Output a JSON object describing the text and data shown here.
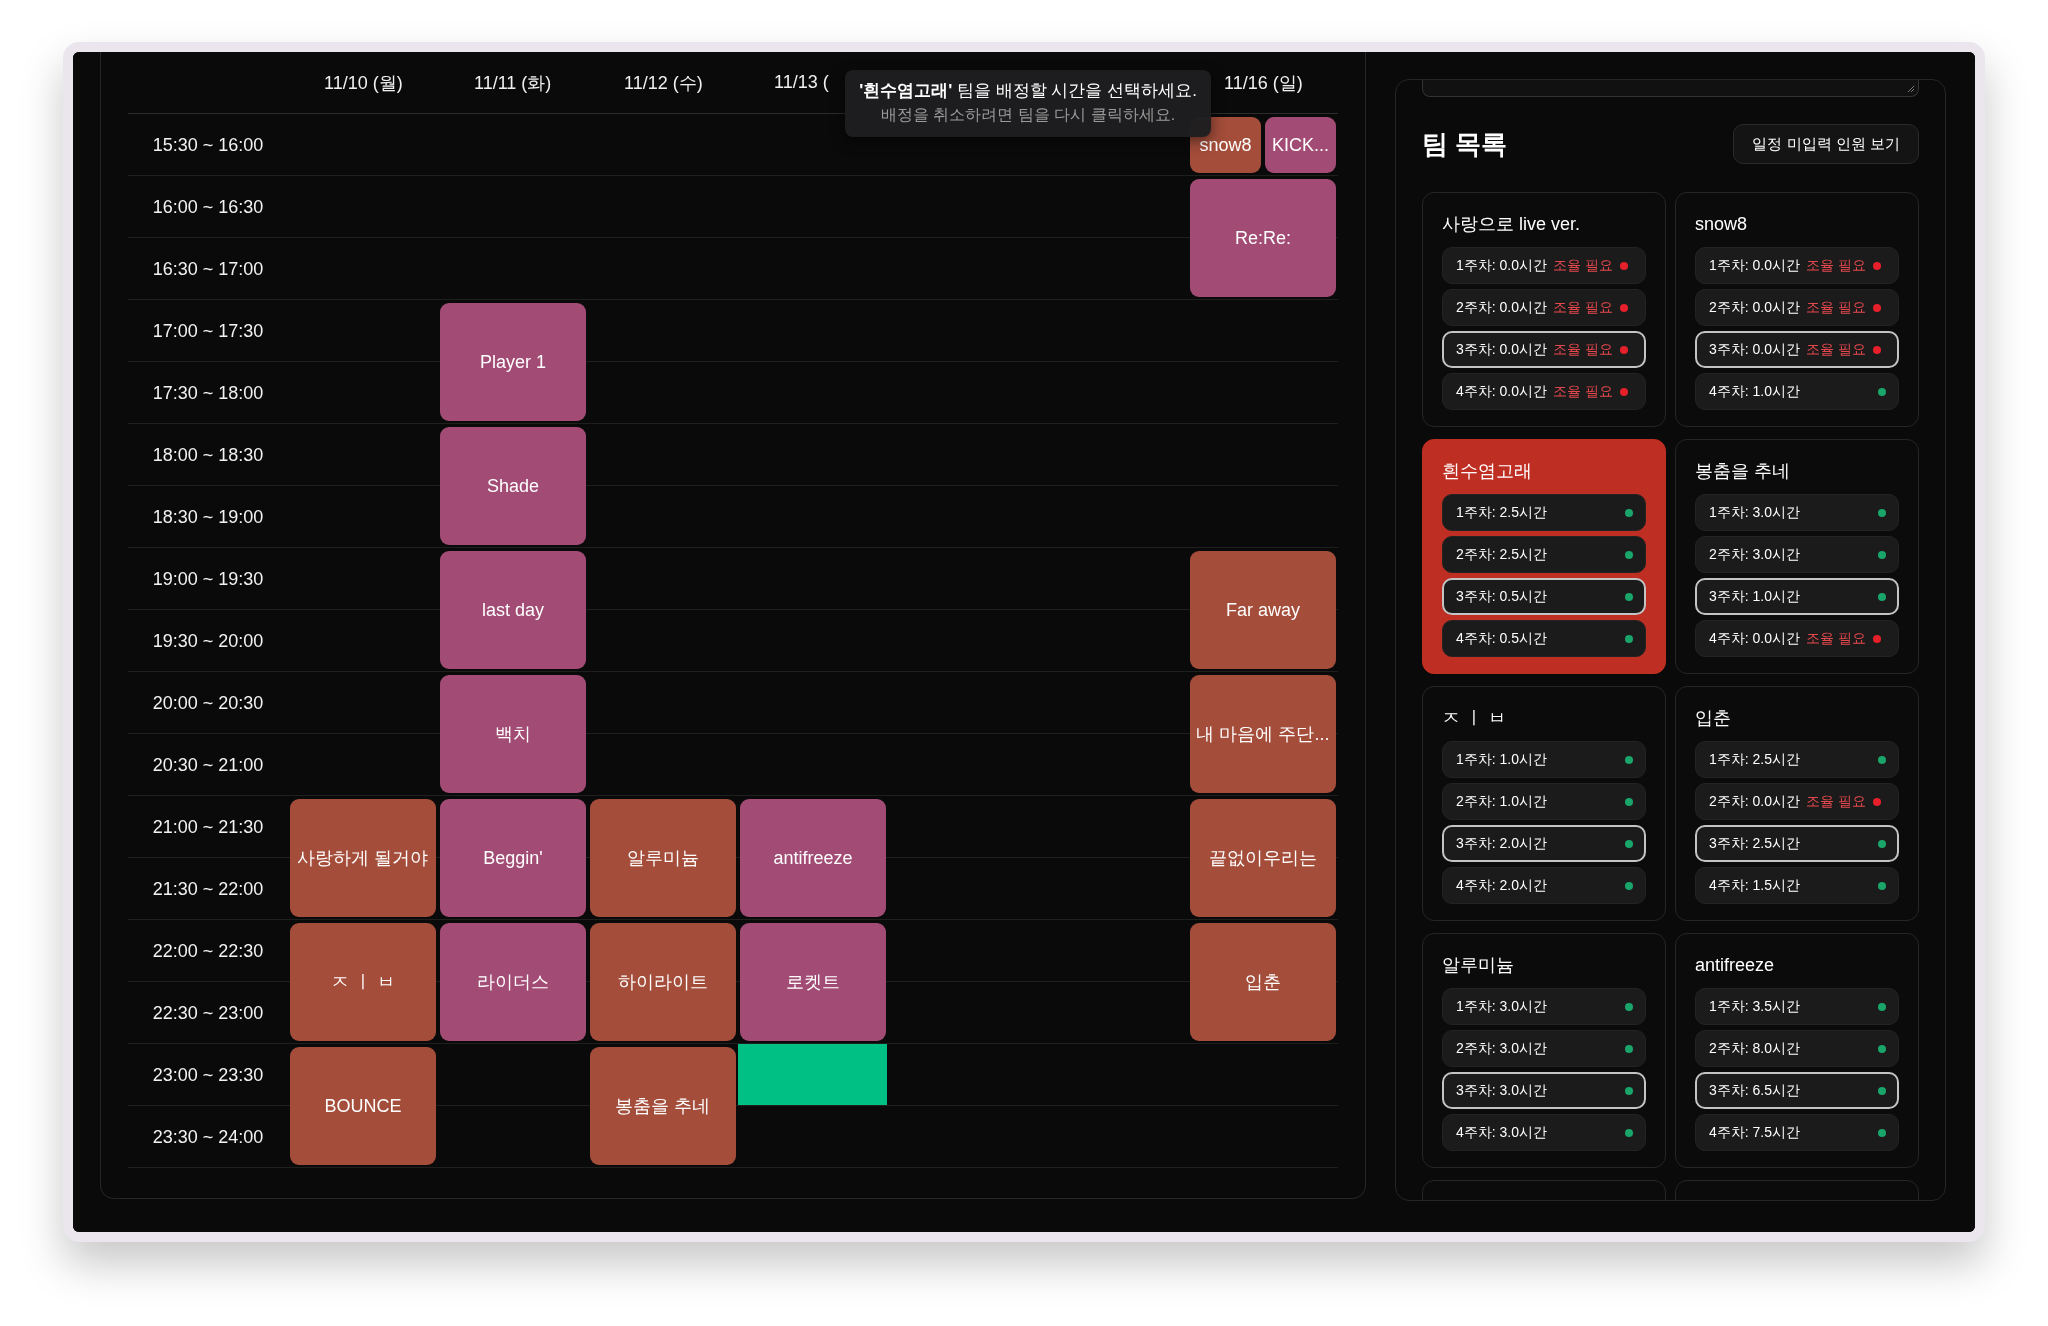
{
  "schedule": {
    "timeslots": [
      {
        "label": "15:30 ~ 16:00"
      },
      {
        "label": "16:00 ~ 16:30"
      },
      {
        "label": "16:30 ~ 17:00"
      },
      {
        "label": "17:00 ~ 17:30"
      },
      {
        "label": "17:30 ~ 18:00"
      },
      {
        "label": "18:00 ~ 18:30"
      },
      {
        "label": "18:30 ~ 19:00"
      },
      {
        "label": "19:00 ~ 19:30"
      },
      {
        "label": "19:30 ~ 20:00"
      },
      {
        "label": "20:00 ~ 20:30"
      },
      {
        "label": "20:30 ~ 21:00"
      },
      {
        "label": "21:00 ~ 21:30"
      },
      {
        "label": "21:30 ~ 22:00"
      },
      {
        "label": "22:00 ~ 22:30"
      },
      {
        "label": "22:30 ~ 23:00"
      },
      {
        "label": "23:00 ~ 23:30"
      },
      {
        "label": "23:30 ~ 24:00"
      }
    ],
    "days": [
      {
        "kind": "day",
        "label": "11/10 (월)",
        "events": [
          {
            "kind": "gap"
          },
          {
            "kind": "gap"
          },
          {
            "kind": "gap"
          },
          {
            "kind": "gap"
          },
          {
            "kind": "gap"
          },
          {
            "kind": "gap"
          },
          {
            "kind": "gap"
          },
          {
            "kind": "gap"
          },
          {
            "kind": "gap"
          },
          {
            "kind": "gap"
          },
          {
            "kind": "gap"
          },
          {
            "kind": "hour",
            "title": "사랑하게 될거야",
            "color": "#a34d3a"
          },
          {
            "kind": "hour",
            "title": "ㅈ ㅣ ㅂ",
            "color": "#a34d3a"
          },
          {
            "kind": "hour",
            "title": "BOUNCE",
            "color": "#a34d3a"
          }
        ]
      },
      {
        "kind": "day",
        "label": "11/11 (화)",
        "events": [
          {
            "kind": "gap"
          },
          {
            "kind": "gap"
          },
          {
            "kind": "gap"
          },
          {
            "kind": "hour",
            "title": "Player 1",
            "color": "#a24b74"
          },
          {
            "kind": "hour",
            "title": "Shade",
            "color": "#a24b74"
          },
          {
            "kind": "hour",
            "title": "last day",
            "color": "#a24b74"
          },
          {
            "kind": "hour",
            "title": "백치",
            "color": "#a24b74"
          },
          {
            "kind": "hour",
            "title": "Beggin'",
            "color": "#a24b74"
          },
          {
            "kind": "hour",
            "title": "라이더스",
            "color": "#a24b74"
          }
        ]
      },
      {
        "kind": "day",
        "label": "11/12 (수)",
        "events": [
          {
            "kind": "gap"
          },
          {
            "kind": "gap"
          },
          {
            "kind": "gap"
          },
          {
            "kind": "gap"
          },
          {
            "kind": "gap"
          },
          {
            "kind": "gap"
          },
          {
            "kind": "gap"
          },
          {
            "kind": "gap"
          },
          {
            "kind": "gap"
          },
          {
            "kind": "gap"
          },
          {
            "kind": "gap"
          },
          {
            "kind": "hour",
            "title": "알루미늄",
            "color": "#a34d3a"
          },
          {
            "kind": "hour",
            "title": "하이라이트",
            "color": "#a34d3a"
          },
          {
            "kind": "hour",
            "title": "봉춤을 추네",
            "color": "#a34d3a"
          }
        ]
      },
      {
        "kind": "day",
        "label": "11/13 (",
        "events": [
          {
            "kind": "gap"
          },
          {
            "kind": "gap"
          },
          {
            "kind": "gap"
          },
          {
            "kind": "gap"
          },
          {
            "kind": "gap"
          },
          {
            "kind": "gap"
          },
          {
            "kind": "gap"
          },
          {
            "kind": "gap"
          },
          {
            "kind": "gap"
          },
          {
            "kind": "gap"
          },
          {
            "kind": "gap"
          },
          {
            "kind": "hour",
            "title": "antifreeze",
            "color": "#a24b74"
          },
          {
            "kind": "hour",
            "title": "로켓트",
            "color": "#a24b74"
          },
          {
            "kind": "preview",
            "color": "#00c084"
          }
        ]
      },
      {
        "kind": "blank"
      },
      {
        "kind": "blank"
      },
      {
        "kind": "day",
        "label": "11/16 (일)",
        "events": [
          {
            "kind": "pair",
            "blocks": [
              {
                "title": "snow8",
                "color": "#a34d3a"
              },
              {
                "title": "KICK...",
                "color": "#a24b74"
              }
            ]
          },
          {
            "kind": "hour",
            "title": "Re:Re:",
            "color": "#a24b74"
          },
          {
            "kind": "gap"
          },
          {
            "kind": "gap"
          },
          {
            "kind": "gap"
          },
          {
            "kind": "gap"
          },
          {
            "kind": "hour",
            "title": "Far away",
            "color": "#a34d3a"
          },
          {
            "kind": "hour",
            "title": "내 마음에 주단...",
            "color": "#a34d3a"
          },
          {
            "kind": "hour",
            "title": "끝없이우리는",
            "color": "#a34d3a"
          },
          {
            "kind": "hour",
            "title": "입춘",
            "color": "#a34d3a"
          }
        ]
      }
    ]
  },
  "tooltip": {
    "title": "**'흰수염고래'** 팀을 배정할 시간을 선택하세요.",
    "hint": "배정을 취소하려면 팀을 다시 클릭하세요."
  },
  "team_panel": {
    "title": "팀 목록",
    "button": "일정 미입력 인원 보기"
  },
  "teams": [
    {
      "name": "사랑으로 live ver.",
      "selected": false,
      "weeks": [
        {
          "label": "1주차: 0.0시간",
          "warning": "조율 필요",
          "ok": false,
          "current": false
        },
        {
          "label": "2주차: 0.0시간",
          "warning": "조율 필요",
          "ok": false,
          "current": false
        },
        {
          "label": "3주차: 0.0시간",
          "warning": "조율 필요",
          "ok": false,
          "current": true
        },
        {
          "label": "4주차: 0.0시간",
          "warning": "조율 필요",
          "ok": false,
          "current": false
        }
      ]
    },
    {
      "name": "snow8",
      "selected": false,
      "weeks": [
        {
          "label": "1주차: 0.0시간",
          "warning": "조율 필요",
          "ok": false,
          "current": false
        },
        {
          "label": "2주차: 0.0시간",
          "warning": "조율 필요",
          "ok": false,
          "current": false
        },
        {
          "label": "3주차: 0.0시간",
          "warning": "조율 필요",
          "ok": false,
          "current": true
        },
        {
          "label": "4주차: 1.0시간",
          "ok": true,
          "current": false
        }
      ]
    },
    {
      "name": "흰수염고래",
      "selected": true,
      "weeks": [
        {
          "label": "1주차: 2.5시간",
          "ok": true,
          "current": false
        },
        {
          "label": "2주차: 2.5시간",
          "ok": true,
          "current": false
        },
        {
          "label": "3주차: 0.5시간",
          "ok": true,
          "current": true
        },
        {
          "label": "4주차: 0.5시간",
          "ok": true,
          "current": false
        }
      ]
    },
    {
      "name": "봉춤을 추네",
      "selected": false,
      "weeks": [
        {
          "label": "1주차: 3.0시간",
          "ok": true,
          "current": false
        },
        {
          "label": "2주차: 3.0시간",
          "ok": true,
          "current": false
        },
        {
          "label": "3주차: 1.0시간",
          "ok": true,
          "current": true
        },
        {
          "label": "4주차: 0.0시간",
          "warning": "조율 필요",
          "ok": false,
          "current": false
        }
      ]
    },
    {
      "name": "ㅈ ㅣ ㅂ",
      "selected": false,
      "weeks": [
        {
          "label": "1주차: 1.0시간",
          "ok": true,
          "current": false
        },
        {
          "label": "2주차: 1.0시간",
          "ok": true,
          "current": false
        },
        {
          "label": "3주차: 2.0시간",
          "ok": true,
          "current": true
        },
        {
          "label": "4주차: 2.0시간",
          "ok": true,
          "current": false
        }
      ]
    },
    {
      "name": "입춘",
      "selected": false,
      "weeks": [
        {
          "label": "1주차: 2.5시간",
          "ok": true,
          "current": false
        },
        {
          "label": "2주차: 0.0시간",
          "warning": "조율 필요",
          "ok": false,
          "current": false
        },
        {
          "label": "3주차: 2.5시간",
          "ok": true,
          "current": true
        },
        {
          "label": "4주차: 1.5시간",
          "ok": true,
          "current": false
        }
      ]
    },
    {
      "name": "알루미늄",
      "selected": false,
      "weeks": [
        {
          "label": "1주차: 3.0시간",
          "ok": true,
          "current": false
        },
        {
          "label": "2주차: 3.0시간",
          "ok": true,
          "current": false
        },
        {
          "label": "3주차: 3.0시간",
          "ok": true,
          "current": true
        },
        {
          "label": "4주차: 3.0시간",
          "ok": true,
          "current": false
        }
      ]
    },
    {
      "name": "antifreeze",
      "selected": false,
      "weeks": [
        {
          "label": "1주차: 3.5시간",
          "ok": true,
          "current": false
        },
        {
          "label": "2주차: 8.0시간",
          "ok": true,
          "current": false
        },
        {
          "label": "3주차: 6.5시간",
          "ok": true,
          "current": true
        },
        {
          "label": "4주차: 7.5시간",
          "ok": true,
          "current": false
        }
      ]
    },
    {
      "selected": false
    },
    {
      "selected": false
    }
  ]
}
